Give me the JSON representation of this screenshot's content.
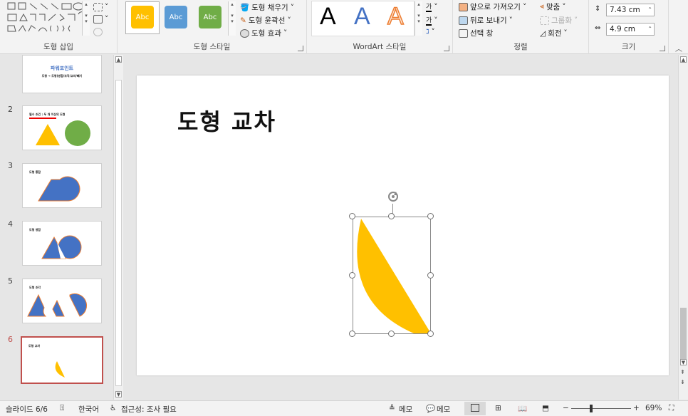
{
  "ribbon": {
    "groups": {
      "insert_shapes": {
        "label": "도형 삽입"
      },
      "shape_styles": {
        "label": "도형 스타일",
        "swatch_text": "Abc",
        "swatch_colors": [
          "#ffc000",
          "#5b9bd5",
          "#70ad47"
        ],
        "fill": "도형 채우기",
        "outline": "도형 윤곽선",
        "effects": "도형 효과"
      },
      "wordart": {
        "label": "WordArt 스타일",
        "sample": "A",
        "text_fill_icon": "가"
      },
      "arrange": {
        "label": "정렬",
        "bring_forward": "앞으로 가져오기",
        "send_backward": "뒤로 보내기",
        "selection_pane": "선택 창",
        "align": "맞춤",
        "group": "그룹화",
        "rotate": "회전"
      },
      "size": {
        "label": "크기",
        "height": "7.43 cm",
        "width": "4.9 cm"
      }
    }
  },
  "thumbnails": [
    {
      "num": "",
      "title": "파워포인트",
      "subtitle": "도형 → 도형(병합/조각/교차/빼기"
    },
    {
      "num": "2",
      "title": "필수 조건 : 두 개 이상의 도형"
    },
    {
      "num": "3",
      "title": "도형 통합"
    },
    {
      "num": "4",
      "title": "도형 병합"
    },
    {
      "num": "5",
      "title": "도형 조각"
    },
    {
      "num": "6",
      "title": "도형 교차"
    }
  ],
  "slide": {
    "title": "도형 교차",
    "shape_color": "#ffc000"
  },
  "status": {
    "slide_indicator": "슬라이드 6/6",
    "language": "한국어",
    "accessibility": "접근성: 조사 필요",
    "notes": "메모",
    "comments": "메모",
    "zoom_minus": "−",
    "zoom_plus": "+",
    "zoom": "69%"
  }
}
